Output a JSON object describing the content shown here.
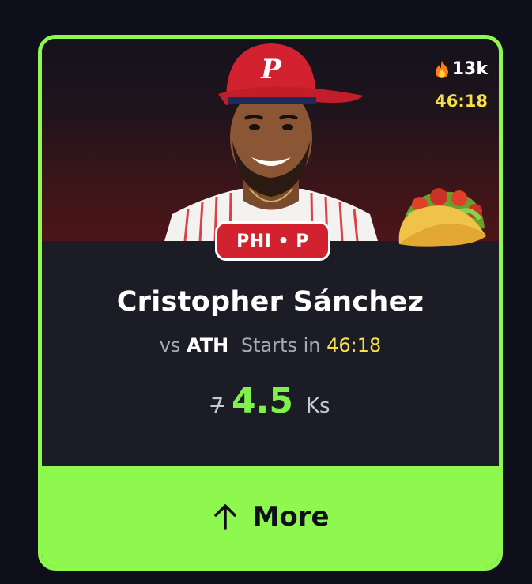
{
  "card": {
    "popularity_count": "13k",
    "popularity_icon": "fire-icon",
    "timer": "46:18",
    "emoji_icon": "taco-icon",
    "team_position": "PHI • P",
    "player_name": "Cristopher Sánchez",
    "vs_label": "vs",
    "opponent": "ATH",
    "starts_label": "Starts in",
    "start_time": "46:18",
    "old_line": "7",
    "new_line": "4.5",
    "stat_unit": "Ks",
    "more_label": "More",
    "more_icon": "arrow-up-icon"
  },
  "colors": {
    "accent_green": "#8ff84f",
    "line_green": "#7ef24a",
    "timer_yellow": "#f5e04a",
    "team_red": "#d22230"
  }
}
